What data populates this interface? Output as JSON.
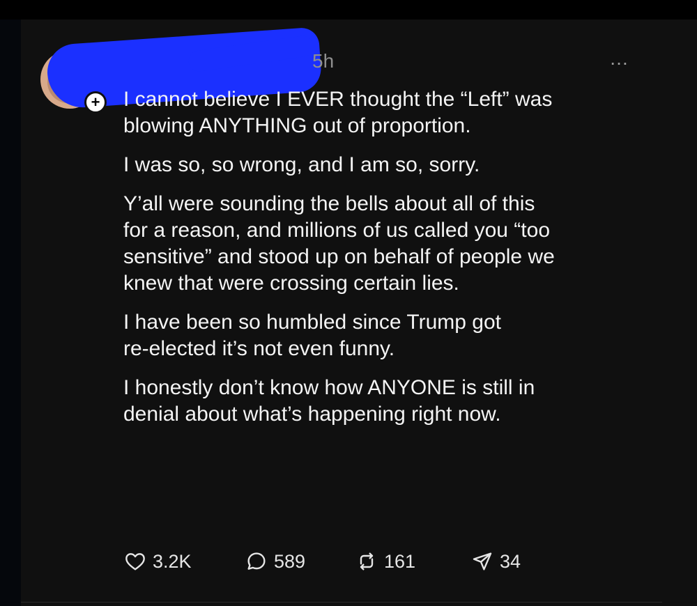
{
  "post": {
    "timestamp": "5h",
    "more_icon": "…",
    "follow_badge_icon": "+",
    "paragraphs": [
      "I cannot believe I EVER thought the “Left” was\nblowing ANYTHING out of proportion.",
      "I was so, so wrong, and I am so, sorry.",
      "Y’all were sounding the bells about all of this\nfor a reason, and millions of us called you “too\nsensitive” and stood up on behalf of people we\nknew that were crossing certain lies.",
      "I have been so humbled since Trump got\nre-elected it’s not even funny.",
      "I honestly don’t know how ANYONE is still in\ndenial about what’s happening right now."
    ],
    "actions": {
      "likes": "3.2K",
      "replies": "589",
      "reposts": "161",
      "shares": "34"
    },
    "colors": {
      "background": "#101010",
      "text": "#f4f4f4",
      "muted": "#8f8f8f",
      "redaction": "#1b30ff"
    }
  }
}
